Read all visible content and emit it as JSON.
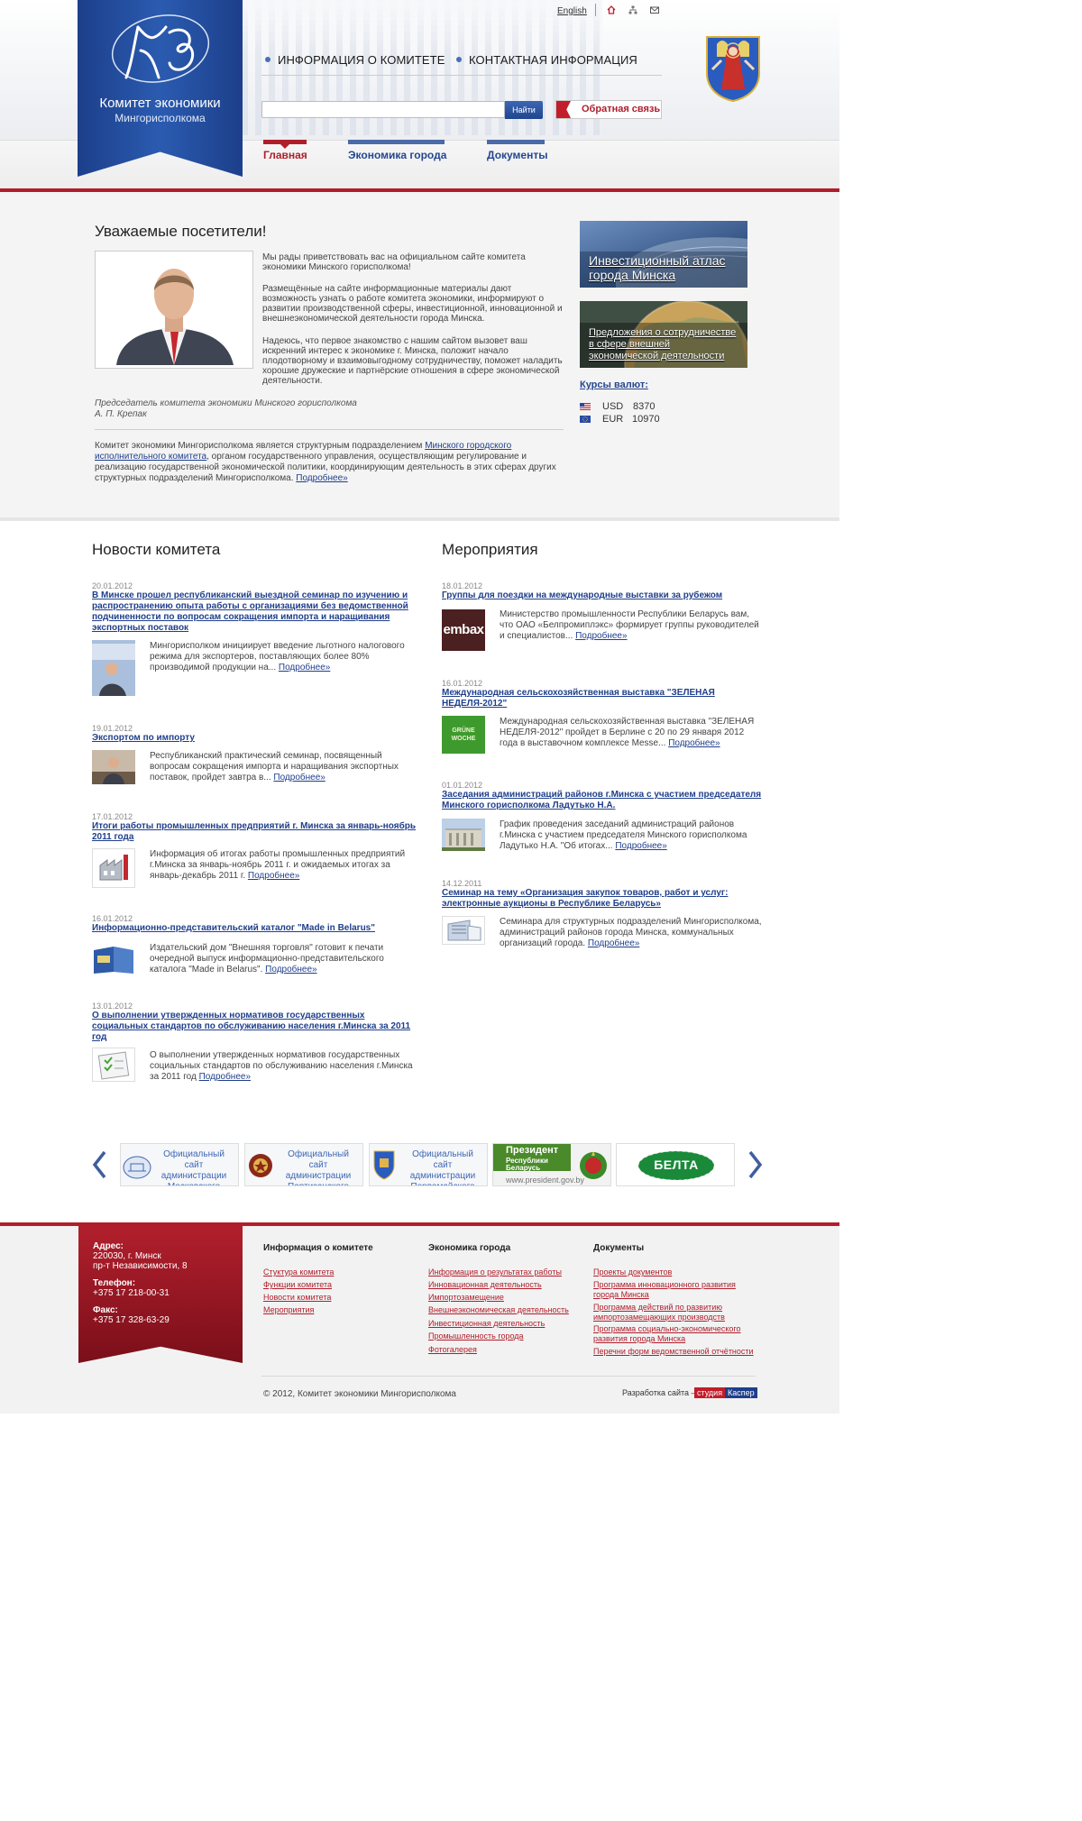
{
  "header": {
    "org_title": "Комитет экономики",
    "org_subtitle": "Мингорисполкома",
    "lang_link": "English",
    "util_icons": [
      "home-icon",
      "sitemap-icon",
      "mail-icon"
    ],
    "top_nav": [
      "ИНФОРМАЦИЯ О КОМИТЕТЕ",
      "КОНТАКТНАЯ ИНФОРМАЦИЯ"
    ],
    "search": {
      "value": "",
      "placeholder": "",
      "button": "Найти"
    },
    "feedback_label": "Обратная связь",
    "main_tabs": [
      {
        "label": "Главная",
        "active": true
      },
      {
        "label": "Экономика города",
        "active": false
      },
      {
        "label": "Документы",
        "active": false
      }
    ]
  },
  "welcome": {
    "title": "Уважаемые посетители!",
    "paragraphs": [
      "Мы рады приветствовать вас на официальном сайте комитета экономики Минского горисполкома!",
      "Размещённые на сайте информационные материалы дают возможность узнать о работе комитета экономики, информируют о развитии производственной сферы, инвестиционной, инновационной и внешнеэкономической деятельности города Минска.",
      "Надеюсь, что первое знакомство с нашим сайтом вызовет ваш искренний интерес к экономике г. Минска, положит начало плодотворному и взаимовыгодному сотрудничеству, поможет наладить хорошие дружеские и партнёрские отношения в сфере экономической деятельности."
    ],
    "signature_role": "Председатель комитета экономики Минского горисполкома",
    "signature_name": "А. П. Крепак",
    "about_before": "Комитет экономики Мингорисполкома является структурным подразделением ",
    "about_link": "Минского городского исполнительного комитета",
    "about_after": ", органом государственного управления, осуществляющим регулирование и реализацию государственной экономической политики, координирующим деятельность в этих сферах других структурных подразделений Мингорисполкома. ",
    "more": "Подробнее»"
  },
  "sidebar": {
    "banner1": "Инвестиционный атлас города Минска",
    "banner2": "Предложения о сотрудничестве в сфере внешней экономической деятельности",
    "rates_title": "Курсы валют:",
    "rates": [
      {
        "code": "USD",
        "value": "8370",
        "flag": "us-flag-icon"
      },
      {
        "code": "EUR",
        "value": "10970",
        "flag": "eu-flag-icon"
      }
    ]
  },
  "news": {
    "title": "Новости комитета",
    "items": [
      {
        "date": "20.01.2012",
        "title": "В Минске прошел республиканский выездной семинар по изучению и распространению опыта работы с организациями без ведомственной подчиненности по вопросам сокращения импорта и наращивания экспортных поставок",
        "text": "Мингорисполком инициирует введение льготного налогового режима для экспортеров, поставляющих более 80% производимой продукции на...",
        "more": "Подробнее»"
      },
      {
        "date": "19.01.2012",
        "title": "Экспортом по импорту",
        "text": "Республиканский практический семинар, посвященный вопросам сокращения импорта и наращивания экспортных поставок, пройдет завтра в...",
        "more": "Подробнее»"
      },
      {
        "date": "17.01.2012",
        "title": "Итоги работы промышленных предприятий г. Минска за январь-ноябрь 2011 года",
        "text": "Информация об итогах работы промышленных предприятий г.Минска за январь-ноябрь 2011 г. и ожидаемых итогах за январь-декабрь 2011 г.",
        "more": "Подробнее»"
      },
      {
        "date": "16.01.2012",
        "title": "Информационно-представительский каталог \"Made in Belarus\"",
        "text": "Издательский дом \"Внешняя торговля\" готовит к печати очередной выпуск информационно-представительского каталога \"Made in Belarus\".",
        "more": "Подробнее»"
      },
      {
        "date": "13.01.2012",
        "title": "О выполнении утвержденных нормативов государственных социальных стандартов по обслуживанию населения г.Минска за 2011 год",
        "text": "О выполнении утвержденных нормативов государственных социальных стандартов по обслуживанию населения г.Минска за 2011 год",
        "more": "Подробнее»"
      }
    ]
  },
  "events": {
    "title": "Мероприятия",
    "items": [
      {
        "date": "18.01.2012",
        "title": "Группы для поездки на международные выставки за рубежом",
        "text": "Министерство промышленности Республики Беларусь вам, что ОАО «Белпромиплэкс» формирует группы руководителей и специалистов...",
        "more": "Подробнее»",
        "thumb_label": "embax"
      },
      {
        "date": "16.01.2012",
        "title": "Международная сельскохозяйственная выставка \"ЗЕЛЕНАЯ НЕДЕЛЯ-2012\"",
        "text": "Международная сельскохозяйственная выставка \"ЗЕЛЕНАЯ НЕДЕЛЯ-2012\" пройдет в Берлине с 20 по 29 января 2012 года в выставочном комплексе Messe...",
        "more": "Подробнее»",
        "thumb_label": "GRÜNE WOCHE"
      },
      {
        "date": "01.01.2012",
        "title": "Заседания администраций районов г.Минска с участием председателя Минского горисполкома Ладутько Н.А.",
        "text": "График проведения заседаний администраций районов г.Минска с участием председателя Минского горисполкома Ладутько Н.А. \"Об итогах...",
        "more": "Подробнее»",
        "thumb_label": ""
      },
      {
        "date": "14.12.2011",
        "title": "Семинар на тему «Организация закупок товаров, работ и услуг: электронные аукционы в Республике Беларусь»",
        "text": "Семинара для структурных подразделений Мингорисполкома, администраций районов города Минска, коммунальных организаций города.",
        "more": "Подробнее»",
        "thumb_label": ""
      }
    ]
  },
  "partners": [
    {
      "text": "Официальный сайт администрации Московского района"
    },
    {
      "text": "Официальный сайт администрации Партизанского района"
    },
    {
      "text": "Официальный сайт администрации Первомайского района"
    },
    {
      "line1": "Президент",
      "line2": "Республики Беларусь",
      "url": "www.president.gov.by"
    },
    {
      "text": "БЕЛТА"
    }
  ],
  "footer": {
    "address_label": "Адрес:",
    "address_lines": [
      "220030, г. Минск",
      "пр-т Независимости, 8"
    ],
    "phone_label": "Телефон:",
    "phone": "+375 17 218-00-31",
    "fax_label": "Факс:",
    "fax": "+375 17 328-63-29",
    "columns": [
      {
        "title": "Информация о комитете",
        "items": [
          "Стуктура комитета",
          "Функции комитета",
          "Новости комитета",
          "Мероприятия"
        ]
      },
      {
        "title": "Экономика города",
        "items": [
          "Информация о результатах работы",
          "Инновационная деятельность",
          "Импортозамещение",
          "Внешнеэкономическая деятельность",
          "Инвестиционная деятельность",
          "Промышленность города",
          "Фотогалерея"
        ]
      },
      {
        "title": "Документы",
        "items": [
          "Проекты документов",
          "Программа инновационного развития города Минска",
          "Программа действий по развитию импортозамещающих производств",
          "Программа социально-экономического развития города Минска",
          "Перечни форм ведомственной отчётности"
        ]
      }
    ],
    "copyright": "© 2012, Комитет экономики Мингорисполкома",
    "developer_label": "Разработка сайта –",
    "developer_b1": "студия",
    "developer_b2": "Каспер"
  }
}
